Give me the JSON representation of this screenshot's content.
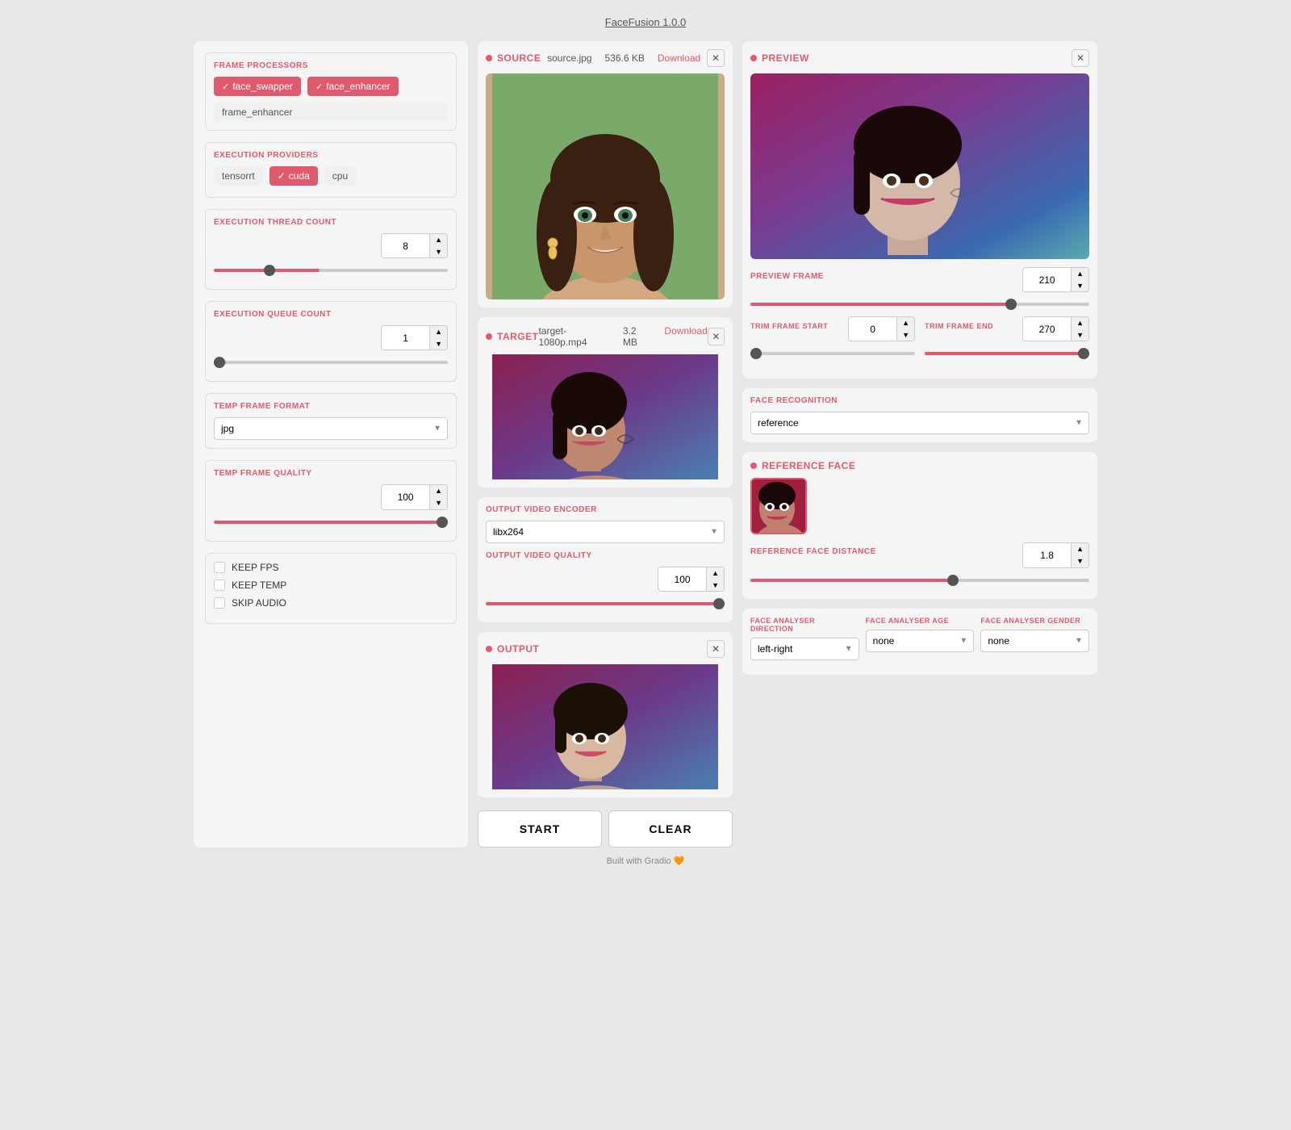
{
  "app": {
    "title": "FaceFusion 1.0.0"
  },
  "left_panel": {
    "frame_processors_label": "FRAME PROCESSORS",
    "chips": [
      {
        "label": "face_swapper",
        "active": true
      },
      {
        "label": "face_enhancer",
        "active": true
      },
      {
        "label": "frame_enhancer",
        "active": false
      }
    ],
    "execution_providers_label": "EXECUTION PROVIDERS",
    "providers": [
      {
        "label": "tensorrt",
        "active": false
      },
      {
        "label": "cuda",
        "active": true
      },
      {
        "label": "cpu",
        "active": false
      }
    ],
    "execution_thread_count_label": "EXECUTION THREAD COUNT",
    "thread_count": "8",
    "execution_queue_count_label": "EXECUTION QUEUE COUNT",
    "queue_count": "1",
    "temp_frame_format_label": "TEMP FRAME FORMAT",
    "temp_frame_format_value": "jpg",
    "temp_frame_quality_label": "TEMP FRAME QUALITY",
    "temp_frame_quality_value": "100",
    "keep_fps_label": "KEEP FPS",
    "keep_temp_label": "KEEP TEMP",
    "skip_audio_label": "SKIP AUDIO"
  },
  "source_panel": {
    "tag": "SOURCE",
    "filename": "source.jpg",
    "filesize": "536.6 KB",
    "download_label": "Download"
  },
  "target_panel": {
    "tag": "TARGET",
    "filename": "target-1080p.mp4",
    "filesize": "3.2 MB",
    "download_label": "Download"
  },
  "output_panel": {
    "tag": "OUTPUT"
  },
  "encoder_panel": {
    "label": "OUTPUT VIDEO ENCODER",
    "value": "libx264",
    "quality_label": "OUTPUT VIDEO QUALITY",
    "quality_value": "100"
  },
  "actions": {
    "start_label": "START",
    "clear_label": "CLEAR"
  },
  "preview_panel": {
    "tag": "PREVIEW",
    "frame_label": "PREVIEW FRAME",
    "frame_value": "210",
    "trim_start_label": "TRIM FRAME START",
    "trim_start_value": "0",
    "trim_end_label": "TRIM FRAME END",
    "trim_end_value": "270"
  },
  "face_recognition_panel": {
    "label": "FACE RECOGNITION",
    "value": "reference"
  },
  "reference_face_panel": {
    "label": "REFERENCE FACE",
    "distance_label": "REFERENCE FACE DISTANCE",
    "distance_value": "1.8"
  },
  "face_analyser_panel": {
    "direction_label": "FACE ANALYSER DIRECTION",
    "direction_value": "left-right",
    "age_label": "FACE ANALYSER AGE",
    "age_value": "none",
    "gender_label": "FACE ANALYSER GENDER",
    "gender_value": "none"
  },
  "footer": {
    "built_with": "Built with Gradio 🧡"
  }
}
